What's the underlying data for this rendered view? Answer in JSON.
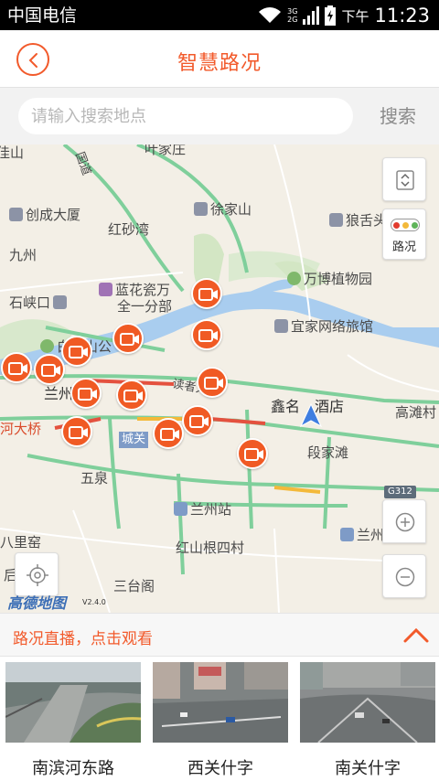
{
  "status_bar": {
    "carrier": "中国电信",
    "network_badge_top": "3G",
    "network_badge_bottom": "2G",
    "ampm": "下午",
    "time": "11:23"
  },
  "header": {
    "title": "智慧路况",
    "back_icon": "chevron-left-icon"
  },
  "search": {
    "placeholder": "请输入搜索地点",
    "button_label": "搜索"
  },
  "map": {
    "labels": {
      "jiashan": "佳山",
      "guodao": "国道",
      "yejiazhuang": "叶家庄",
      "chuangcheng": "创成大厦",
      "hongshawan": "红砂湾",
      "xujiashan": "徐家山",
      "langshan": "狼舌头",
      "jiuzhou": "九州",
      "lanhuaci": "蓝花瓷万",
      "quanyi": "全一分部",
      "wanbo": "万博植物园",
      "shixiakou": "石峡口",
      "yijia": "宜家网络旅馆",
      "baitashan": "白塔山公",
      "lanzhou_short": "兰州",
      "dushu": "读者大道",
      "xinming": "鑫名",
      "hotel": "酒店",
      "gaotan": "高滩村",
      "hedaqiao": "河大桥",
      "chengguan": "城关",
      "duanjiatan": "段家滩",
      "wuquan": "五泉",
      "lanzhou_station": "兰州站",
      "lanzhou_east": "兰州东",
      "balipu": "八里窑",
      "hongshangen": "红山根四村",
      "houlu": "后",
      "santaige": "三台阁",
      "g312": "G312",
      "amap_logo": "高德地图",
      "amap_version": "V2.4.0"
    },
    "traffic_label": "路况",
    "traffic_colors": [
      "#e23b2e",
      "#f3b93a",
      "#5fb45a"
    ],
    "accent_color": "#f05a24",
    "camera_icon": "video-camera-icon",
    "zoom_in_icon": "plus-icon",
    "zoom_out_icon": "minus-icon",
    "locate_icon": "crosshair-icon",
    "layers_icon": "layers-toggle-icon",
    "nav_icon": "navigation-arrow-icon",
    "camera_count": 14
  },
  "live": {
    "title": "路况直播，点击观看",
    "collapse_icon": "chevron-up-icon",
    "feeds": [
      {
        "label": "南滨河东路"
      },
      {
        "label": "西关什字"
      },
      {
        "label": "南关什字"
      }
    ]
  }
}
